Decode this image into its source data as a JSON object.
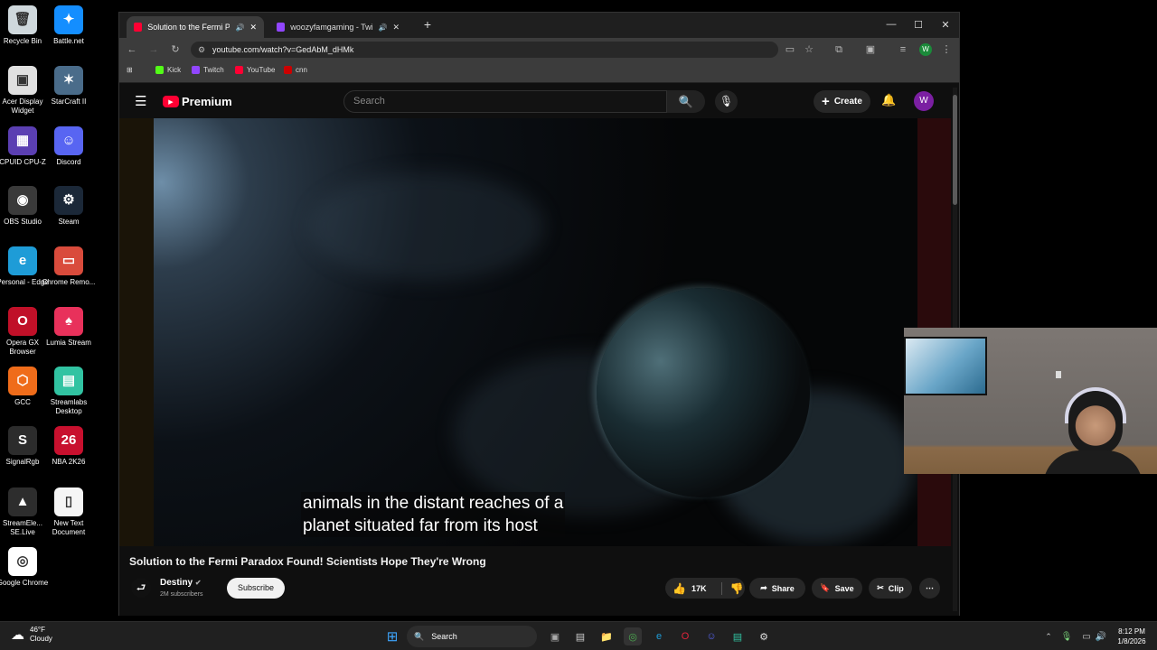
{
  "desktop": {
    "icons": [
      {
        "label": "Recycle Bin",
        "color": "#cfd8dc",
        "glyph": "🗑"
      },
      {
        "label": "Battle.net",
        "color": "#148eff",
        "glyph": "✦"
      },
      {
        "label": "Acer Display Widget",
        "color": "#e0e0e0",
        "glyph": "▣"
      },
      {
        "label": "StarCraft II",
        "color": "#4a6c8a",
        "glyph": "✶"
      },
      {
        "label": "CPUID CPU-Z",
        "color": "#5b3fb2",
        "glyph": "▦"
      },
      {
        "label": "Discord",
        "color": "#5865f2",
        "glyph": "☺"
      },
      {
        "label": "OBS Studio",
        "color": "#3a3a3a",
        "glyph": "◉"
      },
      {
        "label": "Steam",
        "color": "#1b2838",
        "glyph": "⚙"
      },
      {
        "label": "Personal - Edge",
        "color": "#1e9cd7",
        "glyph": "e"
      },
      {
        "label": "Chrome Remo...",
        "color": "#d94b3c",
        "glyph": "▭"
      },
      {
        "label": "Opera GX Browser",
        "color": "#c01028",
        "glyph": "O"
      },
      {
        "label": "Lumia Stream",
        "color": "#e8315b",
        "glyph": "♠"
      },
      {
        "label": "GCC",
        "color": "#ef6c1a",
        "glyph": "⬡"
      },
      {
        "label": "Streamlabs Desktop",
        "color": "#31c3a2",
        "glyph": "▤"
      },
      {
        "label": "SignalRgb",
        "color": "#2c2c2c",
        "glyph": "S"
      },
      {
        "label": "NBA 2K26",
        "color": "#c8102e",
        "glyph": "26"
      },
      {
        "label": "StreamEle... SE.Live",
        "color": "#2d2d2d",
        "glyph": "▲"
      },
      {
        "label": "New Text Document",
        "color": "#f5f5f5",
        "glyph": "▯"
      },
      {
        "label": "Google Chrome",
        "color": "#ffffff",
        "glyph": "◎"
      }
    ]
  },
  "browser": {
    "tabs": [
      {
        "title": "Solution to the Fermi Parad",
        "favicon_color": "#ff0033"
      },
      {
        "title": "woozyfamgaming - Twitch",
        "favicon_color": "#9146ff"
      }
    ],
    "new_tab": "+",
    "controls": {
      "minimize": "—",
      "maximize": "☐",
      "close": "✕"
    },
    "url": "youtube.com/watch?v=GedAbM_dHMk",
    "bookmarks": [
      {
        "label": "Kick",
        "color": "#53fc18"
      },
      {
        "label": "Twitch",
        "color": "#9146ff"
      },
      {
        "label": "YouTube",
        "color": "#ff0033"
      },
      {
        "label": "cnn",
        "color": "#cc0000"
      }
    ],
    "profile_initial": "W"
  },
  "youtube": {
    "logo_text": "Premium",
    "search_placeholder": "Search",
    "create_label": "Create",
    "avatar_initial": "W",
    "caption_line1": "animals in the distant reaches of a",
    "caption_line2": "planet situated far from its host",
    "video_title": "Solution to the Fermi Paradox Found! Scientists Hope They're Wrong",
    "channel_name": "Destiny",
    "subscriber_count": "2M subscribers",
    "subscribe_label": "Subscribe",
    "like_count": "17K",
    "share_label": "Share",
    "save_label": "Save",
    "clip_label": "Clip"
  },
  "taskbar": {
    "weather_temp": "46°F",
    "weather_desc": "Cloudy",
    "search_label": "Search",
    "time": "8:12 PM",
    "date": "1/8/2026"
  }
}
